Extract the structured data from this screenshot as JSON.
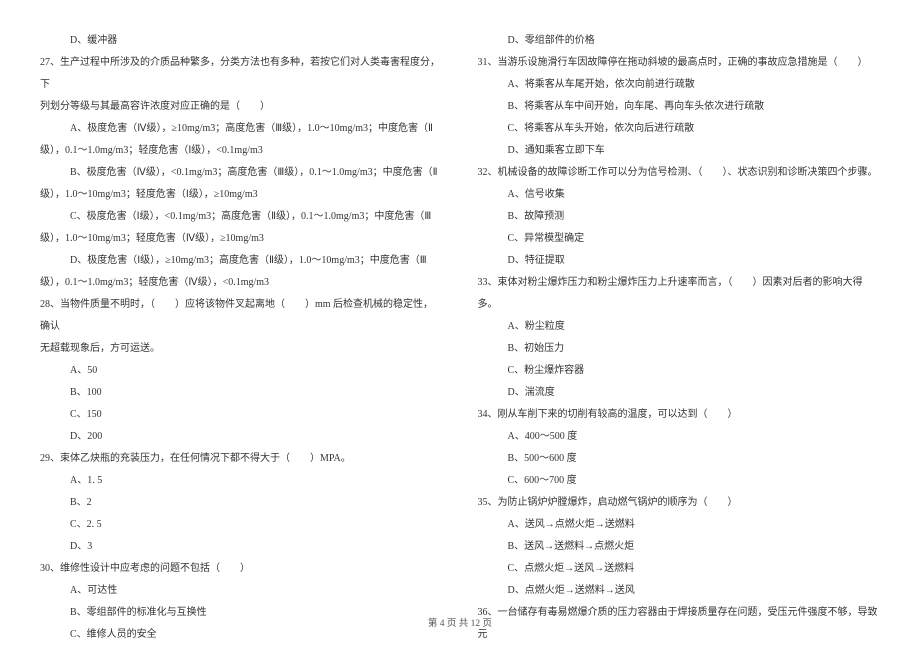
{
  "left": {
    "q26_d": "D、缓冲器",
    "q27_stem_l1": "27、生产过程中所涉及的介质品种繁多，分类方法也有多种，若按它们对人类毒害程度分，下",
    "q27_stem_l2": "列划分等级与其最高容许浓度对应正确的是（　　）",
    "q27_a_l1": "A、极度危害（Ⅳ级），≥10mg/m3；高度危害（Ⅲ级），1.0～10mg/m3；中度危害（Ⅱ",
    "q27_a_l2": "级），0.1～1.0mg/m3；轻度危害（Ⅰ级），<0.1mg/m3",
    "q27_b_l1": "B、极度危害（Ⅳ级），<0.1mg/m3；高度危害（Ⅲ级），0.1～1.0mg/m3；中度危害（Ⅱ",
    "q27_b_l2": "级），1.0～10mg/m3；轻度危害（Ⅰ级），≥10mg/m3",
    "q27_c_l1": "C、极度危害（Ⅰ级），<0.1mg/m3；高度危害（Ⅱ级），0.1～1.0mg/m3；中度危害（Ⅲ",
    "q27_c_l2": "级），1.0～10mg/m3；轻度危害（Ⅳ级），≥10mg/m3",
    "q27_d_l1": "D、极度危害（Ⅰ级），≥10mg/m3；高度危害（Ⅱ级），1.0～10mg/m3；中度危害（Ⅲ",
    "q27_d_l2": "级），0.1～1.0mg/m3；轻度危害（Ⅳ级），<0.1mg/m3",
    "q28_l1": "28、当物件质量不明时，（　　）应将该物件叉起离地（　　）mm 后检查机械的稳定性，确认",
    "q28_l2": "无超载现象后，方可运送。",
    "q28_a": "A、50",
    "q28_b": "B、100",
    "q28_c": "C、150",
    "q28_d": "D、200",
    "q29": "29、束体乙炔瓶的充装压力，在任何情况下都不得大于（　　）MPA。",
    "q29_a": "A、1. 5",
    "q29_b": "B、2",
    "q29_c": "C、2. 5",
    "q29_d": "D、3",
    "q30": "30、维修性设计中应考虑的问题不包括（　　）",
    "q30_a": "A、可达性",
    "q30_b": "B、零组部件的标准化与互换性",
    "q30_c": "C、维修人员的安全"
  },
  "right": {
    "q30_d": "D、零组部件的价格",
    "q31": "31、当游乐设施滑行车因故障停在拖动斜坡的最高点时，正确的事故应急措施是（　　）",
    "q31_a": "A、将乘客从车尾开始，依次向前进行疏散",
    "q31_b": "B、将乘客从车中间开始，向车尾、再向车头依次进行疏散",
    "q31_c": "C、将乘客从车头开始，依次向后进行疏散",
    "q31_d": "D、通知乘客立即下车",
    "q32": "32、机械设备的故障诊断工作可以分为信号检测、（　　）、状态识别和诊断决策四个步骤。",
    "q32_a": "A、信号收集",
    "q32_b": "B、故障预测",
    "q32_c": "C、异常模型确定",
    "q32_d": "D、特征提取",
    "q33": "33、束体对粉尘爆炸压力和粉尘爆炸压力上升速率而言，（　　）因素对后者的影响大得多。",
    "q33_a": "A、粉尘粒度",
    "q33_b": "B、初始压力",
    "q33_c": "C、粉尘爆炸容器",
    "q33_d": "D、湍流度",
    "q34": "34、刚从车削下来的切削有较高的温度，可以达到（　　）",
    "q34_a": "A、400～500 度",
    "q34_b": "B、500～600 度",
    "q34_c": "C、600～700 度",
    "q35": "35、为防止锅炉炉膛爆炸，启动燃气锅炉的顺序为（　　）",
    "q35_a": "A、送风→点燃火炬→送燃料",
    "q35_b": "B、送风→送燃料→点燃火炬",
    "q35_c": "C、点燃火炬→送风→送燃料",
    "q35_d": "D、点燃火炬→送燃料→送风",
    "q36": "36、一台储存有毒易燃爆介质的压力容器由于焊接质量存在问题，受压元件强度不够，导致元"
  },
  "footer": "第 4 页 共 12 页"
}
